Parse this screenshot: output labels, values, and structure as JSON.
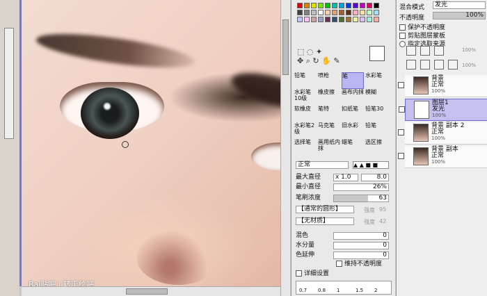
{
  "canvas": {
    "watermark": "Bai贴吧 | 转手绘吧"
  },
  "tools_panel": {
    "palette_colors": [
      "#e00000",
      "#e08000",
      "#e0e000",
      "#80e000",
      "#00c000",
      "#00c0a0",
      "#00a0e0",
      "#0040e0",
      "#6000e0",
      "#c000c0",
      "#e0006a",
      "#000000",
      "#404040",
      "#808080",
      "#c0c0c0",
      "#ffffff",
      "#f8d0b0",
      "#e0a070",
      "#a06030",
      "#603010",
      "#ffb0c0",
      "#ffe0a0",
      "#c0ffc0",
      "#a0e0ff",
      "#c0c0ff",
      "#ffc0ff",
      "#d0a0a0",
      "#a0a0d0",
      "#703050",
      "#305070",
      "#507030",
      "#a07030",
      "#f0f0a0",
      "#e0c0f0",
      "#a0f0e0",
      "#f0b0a0"
    ],
    "tools": [
      "铅笔",
      "喷枪",
      "笔",
      "水彩笔",
      "水彩笔10级",
      "橡皮擦",
      "画布内抹",
      "模糊",
      "软橡皮",
      "笔特",
      "扣纸笔",
      "铅笔30",
      "水彩笔2级",
      "马克笔",
      "旧水彩",
      "铅笔",
      "选择笔",
      "画用纸内抹",
      "蜡笔",
      "选区擦"
    ],
    "selected_tool_index": 2,
    "blend_mode": "正常",
    "max_diameter_label": "最大直径",
    "max_diameter_mult": "x 1.0",
    "max_diameter_value": "8.0",
    "min_diameter_label": "最小直径",
    "min_diameter_value": "26%",
    "density_label": "笔刷浓度",
    "density_value": "63",
    "shape_select": "【通常的圆形】",
    "shape_intensity_label": "强度",
    "shape_intensity_value": "95",
    "texture_select": "【无材质】",
    "texture_intensity_label": "强度",
    "texture_intensity_value": "42",
    "mix_label": "混色",
    "mix_value": "0",
    "water_label": "水分量",
    "water_value": "0",
    "extend_label": "色延伸",
    "extend_value": "0",
    "keep_opacity_label": "维持不透明度",
    "detail_label": "详细设置",
    "size_presets": [
      "0.7",
      "0.8",
      "1",
      "1.5",
      "2"
    ]
  },
  "layers_panel": {
    "blend_mode_label": "混合模式",
    "blend_mode_value": "发光",
    "opacity_label": "不透明度",
    "opacity_value": "100%",
    "protect_opacity": "保护不透明度",
    "clip_group": "剪贴图层蒙板",
    "selection_source": "指定选取来源",
    "layers": [
      {
        "name": "背景",
        "mode": "正常",
        "opacity": "100%"
      },
      {
        "name": "图层1",
        "mode": "发光",
        "opacity": "100%"
      },
      {
        "name": "背景 副本 2",
        "mode": "正常",
        "opacity": "100%"
      },
      {
        "name": "背景 副本",
        "mode": "正常",
        "opacity": "100%"
      }
    ],
    "zoom_label_a": "100%",
    "zoom_label_b": "100%"
  }
}
